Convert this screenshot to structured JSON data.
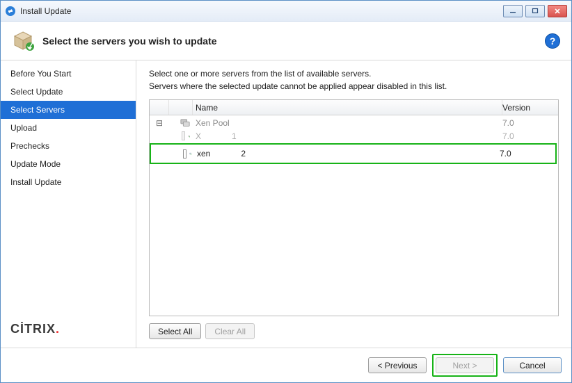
{
  "window": {
    "title": "Install Update"
  },
  "header": {
    "heading": "Select the servers you wish to update"
  },
  "sidebar": {
    "steps": [
      {
        "label": "Before You Start"
      },
      {
        "label": "Select Update"
      },
      {
        "label": "Select Servers"
      },
      {
        "label": "Upload"
      },
      {
        "label": "Prechecks"
      },
      {
        "label": "Update Mode"
      },
      {
        "label": "Install Update"
      }
    ],
    "active_index": 2
  },
  "content": {
    "line1": "Select one or more servers from the list of available servers.",
    "line2": "Servers where the selected update cannot be applied appear disabled in this list.",
    "columns": {
      "name": "Name",
      "version": "Version"
    },
    "pool": {
      "name": "Xen Pool",
      "version": "7.0"
    },
    "servers": [
      {
        "name": "X",
        "suffix": "1",
        "version": "7.0"
      },
      {
        "name": "xen",
        "suffix": "2",
        "version": "7.0"
      }
    ],
    "buttons": {
      "select_all": "Select All",
      "clear_all": "Clear All"
    }
  },
  "footer": {
    "previous": "< Previous",
    "next": "Next >",
    "cancel": "Cancel"
  },
  "brand": {
    "text": "CİTRIX",
    "dot": "."
  }
}
